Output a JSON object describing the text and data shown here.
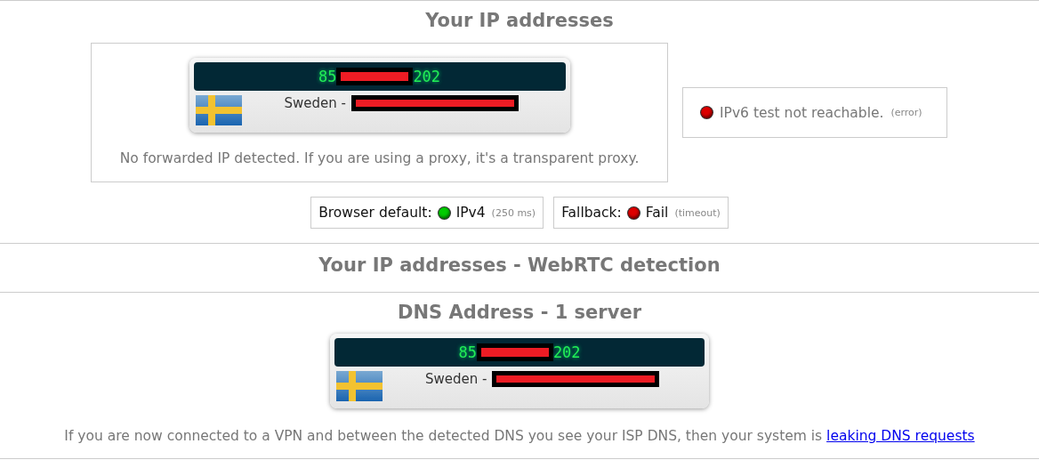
{
  "ip_section": {
    "title": "Your IP addresses",
    "ip_card": {
      "ip_start": "85",
      "ip_end": "202",
      "country": "Sweden -",
      "redacted": true
    },
    "note": "No forwarded IP detected. If you are using a proxy, it's a transparent proxy.",
    "ipv6": {
      "color": "#dd0000",
      "text": "IPv6 test not reachable.",
      "detail": "(error)"
    },
    "checks": [
      {
        "label": "Browser default:",
        "color": "#00cc00",
        "value": "IPv4",
        "detail": "(250 ms)"
      },
      {
        "label": "Fallback:",
        "color": "#dd0000",
        "value": "Fail",
        "detail": "(timeout)"
      }
    ]
  },
  "webrtc_section": {
    "title": "Your IP addresses - WebRTC detection"
  },
  "dns_section": {
    "title": "DNS Address - 1 server",
    "ip_card": {
      "ip_start": "85",
      "ip_end": "202",
      "country": "Sweden -",
      "redacted": true
    },
    "note": "If you are now connected to a VPN and between the detected DNS you see your ISP DNS, then your system is",
    "link": "leaking DNS requests"
  }
}
